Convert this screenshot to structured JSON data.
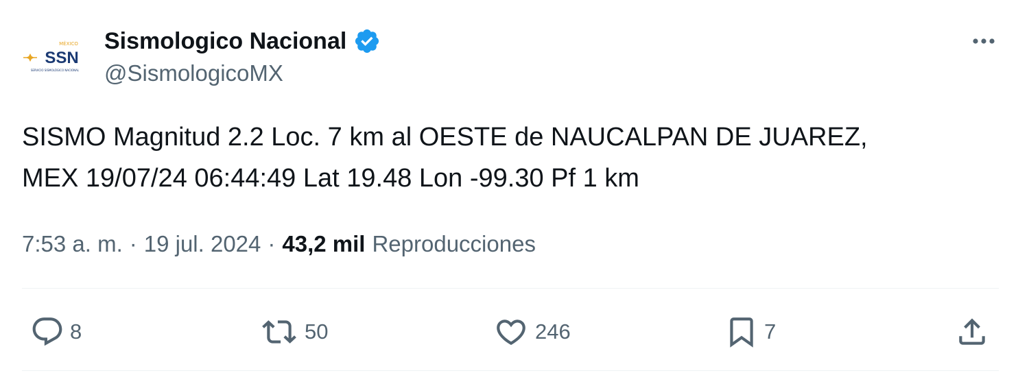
{
  "author": {
    "display_name": "Sismologico Nacional",
    "handle": "@SismologicoMX",
    "verified": true,
    "avatar_icon": "ssn-logo",
    "avatar_logo": {
      "main": "SSN",
      "top": "MÉXICO",
      "sub": "SERVICIO SISMOLÓGICO NACIONAL"
    }
  },
  "tweet": {
    "text": "SISMO Magnitud 2.2 Loc. 7 km al OESTE de NAUCALPAN DE JUAREZ,\nMEX 19/07/24 06:44:49 Lat 19.48 Lon -99.30 Pf 1 km"
  },
  "meta": {
    "time": "7:53 a. m.",
    "separator": "·",
    "date": "19 jul. 2024",
    "views_count": "43,2 mil",
    "views_label": "Reproducciones"
  },
  "actions": {
    "reply_count": "8",
    "retweet_count": "50",
    "like_count": "246",
    "bookmark_count": "7"
  },
  "colors": {
    "text": "#0f1419",
    "secondary": "#536471",
    "verified_blue": "#1d9bf0",
    "divider": "#eff3f4",
    "logo_navy": "#1b3a73",
    "logo_gold": "#e8a623"
  }
}
